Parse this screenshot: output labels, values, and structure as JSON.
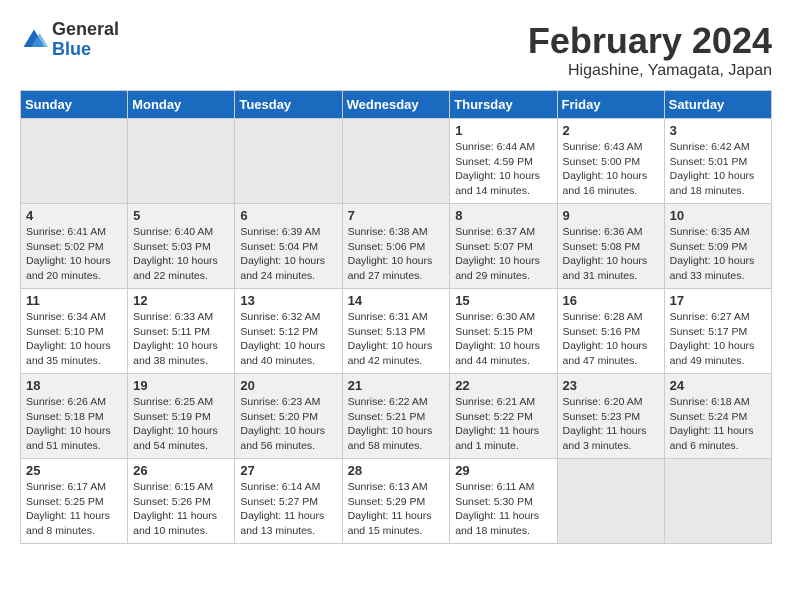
{
  "header": {
    "logo_general": "General",
    "logo_blue": "Blue",
    "main_title": "February 2024",
    "subtitle": "Higashine, Yamagata, Japan"
  },
  "weekdays": [
    "Sunday",
    "Monday",
    "Tuesday",
    "Wednesday",
    "Thursday",
    "Friday",
    "Saturday"
  ],
  "weeks": [
    [
      {
        "day": "",
        "info": ""
      },
      {
        "day": "",
        "info": ""
      },
      {
        "day": "",
        "info": ""
      },
      {
        "day": "",
        "info": ""
      },
      {
        "day": "1",
        "info": "Sunrise: 6:44 AM\nSunset: 4:59 PM\nDaylight: 10 hours and 14 minutes."
      },
      {
        "day": "2",
        "info": "Sunrise: 6:43 AM\nSunset: 5:00 PM\nDaylight: 10 hours and 16 minutes."
      },
      {
        "day": "3",
        "info": "Sunrise: 6:42 AM\nSunset: 5:01 PM\nDaylight: 10 hours and 18 minutes."
      }
    ],
    [
      {
        "day": "4",
        "info": "Sunrise: 6:41 AM\nSunset: 5:02 PM\nDaylight: 10 hours and 20 minutes."
      },
      {
        "day": "5",
        "info": "Sunrise: 6:40 AM\nSunset: 5:03 PM\nDaylight: 10 hours and 22 minutes."
      },
      {
        "day": "6",
        "info": "Sunrise: 6:39 AM\nSunset: 5:04 PM\nDaylight: 10 hours and 24 minutes."
      },
      {
        "day": "7",
        "info": "Sunrise: 6:38 AM\nSunset: 5:06 PM\nDaylight: 10 hours and 27 minutes."
      },
      {
        "day": "8",
        "info": "Sunrise: 6:37 AM\nSunset: 5:07 PM\nDaylight: 10 hours and 29 minutes."
      },
      {
        "day": "9",
        "info": "Sunrise: 6:36 AM\nSunset: 5:08 PM\nDaylight: 10 hours and 31 minutes."
      },
      {
        "day": "10",
        "info": "Sunrise: 6:35 AM\nSunset: 5:09 PM\nDaylight: 10 hours and 33 minutes."
      }
    ],
    [
      {
        "day": "11",
        "info": "Sunrise: 6:34 AM\nSunset: 5:10 PM\nDaylight: 10 hours and 35 minutes."
      },
      {
        "day": "12",
        "info": "Sunrise: 6:33 AM\nSunset: 5:11 PM\nDaylight: 10 hours and 38 minutes."
      },
      {
        "day": "13",
        "info": "Sunrise: 6:32 AM\nSunset: 5:12 PM\nDaylight: 10 hours and 40 minutes."
      },
      {
        "day": "14",
        "info": "Sunrise: 6:31 AM\nSunset: 5:13 PM\nDaylight: 10 hours and 42 minutes."
      },
      {
        "day": "15",
        "info": "Sunrise: 6:30 AM\nSunset: 5:15 PM\nDaylight: 10 hours and 44 minutes."
      },
      {
        "day": "16",
        "info": "Sunrise: 6:28 AM\nSunset: 5:16 PM\nDaylight: 10 hours and 47 minutes."
      },
      {
        "day": "17",
        "info": "Sunrise: 6:27 AM\nSunset: 5:17 PM\nDaylight: 10 hours and 49 minutes."
      }
    ],
    [
      {
        "day": "18",
        "info": "Sunrise: 6:26 AM\nSunset: 5:18 PM\nDaylight: 10 hours and 51 minutes."
      },
      {
        "day": "19",
        "info": "Sunrise: 6:25 AM\nSunset: 5:19 PM\nDaylight: 10 hours and 54 minutes."
      },
      {
        "day": "20",
        "info": "Sunrise: 6:23 AM\nSunset: 5:20 PM\nDaylight: 10 hours and 56 minutes."
      },
      {
        "day": "21",
        "info": "Sunrise: 6:22 AM\nSunset: 5:21 PM\nDaylight: 10 hours and 58 minutes."
      },
      {
        "day": "22",
        "info": "Sunrise: 6:21 AM\nSunset: 5:22 PM\nDaylight: 11 hours and 1 minute."
      },
      {
        "day": "23",
        "info": "Sunrise: 6:20 AM\nSunset: 5:23 PM\nDaylight: 11 hours and 3 minutes."
      },
      {
        "day": "24",
        "info": "Sunrise: 6:18 AM\nSunset: 5:24 PM\nDaylight: 11 hours and 6 minutes."
      }
    ],
    [
      {
        "day": "25",
        "info": "Sunrise: 6:17 AM\nSunset: 5:25 PM\nDaylight: 11 hours and 8 minutes."
      },
      {
        "day": "26",
        "info": "Sunrise: 6:15 AM\nSunset: 5:26 PM\nDaylight: 11 hours and 10 minutes."
      },
      {
        "day": "27",
        "info": "Sunrise: 6:14 AM\nSunset: 5:27 PM\nDaylight: 11 hours and 13 minutes."
      },
      {
        "day": "28",
        "info": "Sunrise: 6:13 AM\nSunset: 5:29 PM\nDaylight: 11 hours and 15 minutes."
      },
      {
        "day": "29",
        "info": "Sunrise: 6:11 AM\nSunset: 5:30 PM\nDaylight: 11 hours and 18 minutes."
      },
      {
        "day": "",
        "info": ""
      },
      {
        "day": "",
        "info": ""
      }
    ]
  ]
}
